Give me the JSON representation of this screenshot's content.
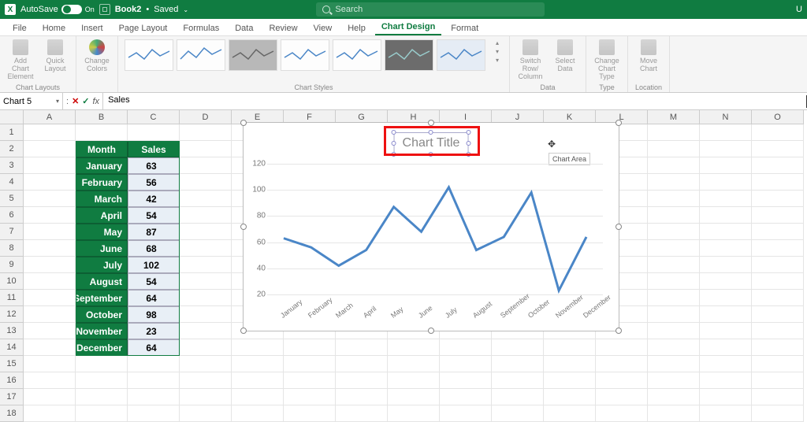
{
  "titlebar": {
    "autosave_label": "AutoSave",
    "autosave_state": "On",
    "doc_name": "Book2",
    "doc_state": "Saved",
    "search_placeholder": "Search"
  },
  "tabs": [
    "File",
    "Home",
    "Insert",
    "Page Layout",
    "Formulas",
    "Data",
    "Review",
    "View",
    "Help",
    "Chart Design",
    "Format"
  ],
  "active_tab": "Chart Design",
  "ribbon": {
    "layouts": {
      "add": "Add Chart\nElement",
      "quick": "Quick\nLayout",
      "label": "Chart Layouts"
    },
    "colors": {
      "btn": "Change\nColors"
    },
    "styles": {
      "label": "Chart Styles"
    },
    "data": {
      "switch": "Switch Row/\nColumn",
      "select": "Select\nData",
      "label": "Data"
    },
    "type": {
      "change": "Change\nChart Type",
      "label": "Type"
    },
    "location": {
      "move": "Move\nChart",
      "label": "Location"
    }
  },
  "namebox": "Chart 5",
  "formula": "Sales",
  "columns": [
    "A",
    "B",
    "C",
    "D",
    "E",
    "F",
    "G",
    "H",
    "I",
    "J",
    "K",
    "L",
    "M",
    "N",
    "O"
  ],
  "rowcount": 18,
  "table": {
    "headers": [
      "Month",
      "Sales"
    ],
    "rows": [
      {
        "m": "January",
        "v": 63
      },
      {
        "m": "February",
        "v": 56
      },
      {
        "m": "March",
        "v": 42
      },
      {
        "m": "April",
        "v": 54
      },
      {
        "m": "May",
        "v": 87
      },
      {
        "m": "June",
        "v": 68
      },
      {
        "m": "July",
        "v": 102
      },
      {
        "m": "August",
        "v": 54
      },
      {
        "m": "September",
        "v": 64
      },
      {
        "m": "October",
        "v": 98
      },
      {
        "m": "November",
        "v": 23
      },
      {
        "m": "December",
        "v": 64
      }
    ]
  },
  "chart": {
    "title": "Chart Title",
    "tooltip": "Chart Area"
  },
  "chart_data": {
    "type": "line",
    "title": "Chart Title",
    "x_field": "Month",
    "y_field": "Sales",
    "categories": [
      "January",
      "February",
      "March",
      "April",
      "May",
      "June",
      "July",
      "August",
      "September",
      "October",
      "November",
      "December"
    ],
    "values": [
      63,
      56,
      42,
      54,
      87,
      68,
      102,
      54,
      64,
      98,
      23,
      64
    ],
    "ylim": [
      20,
      120
    ],
    "yticks": [
      20,
      40,
      60,
      80,
      100,
      120
    ],
    "xlabel": "",
    "ylabel": ""
  }
}
